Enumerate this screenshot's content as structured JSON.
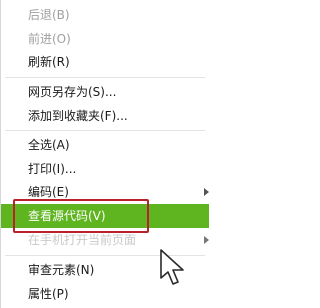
{
  "menu": {
    "items": [
      {
        "label": "后退(B)",
        "state": "disabled"
      },
      {
        "label": "前进(O)",
        "state": "disabled"
      },
      {
        "label": "刷新(R)",
        "state": "normal"
      },
      {
        "label": "网页另存为(S)...",
        "state": "normal"
      },
      {
        "label": "添加到收藏夹(F)...",
        "state": "normal"
      },
      {
        "label": "全选(A)",
        "state": "normal"
      },
      {
        "label": "打印(I)...",
        "state": "normal"
      },
      {
        "label": "编码(E)",
        "state": "normal",
        "submenu": true
      },
      {
        "label": "查看源代码(V)",
        "state": "highlighted"
      },
      {
        "label": "在手机打开当前页面",
        "state": "faded",
        "submenu": true
      },
      {
        "label": "审查元素(N)",
        "state": "normal"
      },
      {
        "label": "属性(P)",
        "state": "normal"
      }
    ]
  },
  "colors": {
    "highlight": "#5fb520",
    "annotation_box": "#b8222a",
    "disabled_text": "#a0a0a0"
  },
  "icons": {
    "submenu": "submenu-arrow-icon",
    "cursor": "mouse-pointer-icon"
  }
}
